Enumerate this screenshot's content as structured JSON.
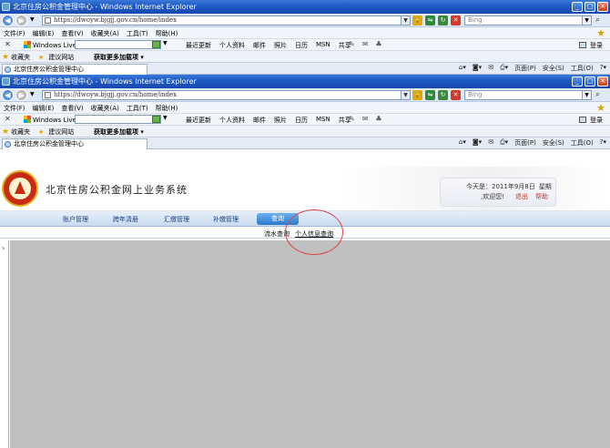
{
  "browser": {
    "window_title": "北京住房公积金管理中心 - Windows Internet Explorer",
    "address": "https://dwoyw.bjgjj.gov.cn/home/index",
    "search_placeholder": "Bing",
    "menu": [
      "文件(F)",
      "编辑(E)",
      "查看(V)",
      "收藏夹(A)",
      "工具(T)",
      "帮助(H)"
    ],
    "windows_live": "Windows Live",
    "live_links": [
      "最近更新",
      "个人资料",
      "邮件",
      "照片",
      "日历",
      "MSN",
      "共享"
    ],
    "login": "登录",
    "favorites": "收藏夹",
    "suggested_sites": "建议网站",
    "more_addons": "获取更多加载项",
    "tab_title": "北京住房公积金管理中心",
    "command_bar": [
      "页面(P)",
      "安全(S)",
      "工具(O)"
    ]
  },
  "site": {
    "system_name": "北京住房公积金网上业务系统",
    "date_label": "今天是：2011年9月8日",
    "weekday": "星期四",
    "welcome": ",欢迎您!",
    "logout": "退出",
    "help": "帮助",
    "nav": [
      "账户管理",
      "跨年清册",
      "汇缴管理",
      "补缴管理",
      "查询"
    ],
    "subnav": [
      "流水查询",
      "个人信息查询"
    ],
    "left_toggle": "›"
  },
  "colors": {
    "title_bar": "#1f5bc4",
    "nav_active": "#2b79cf",
    "content_bg": "#c0c0c0",
    "annotation": "#dd4444"
  }
}
